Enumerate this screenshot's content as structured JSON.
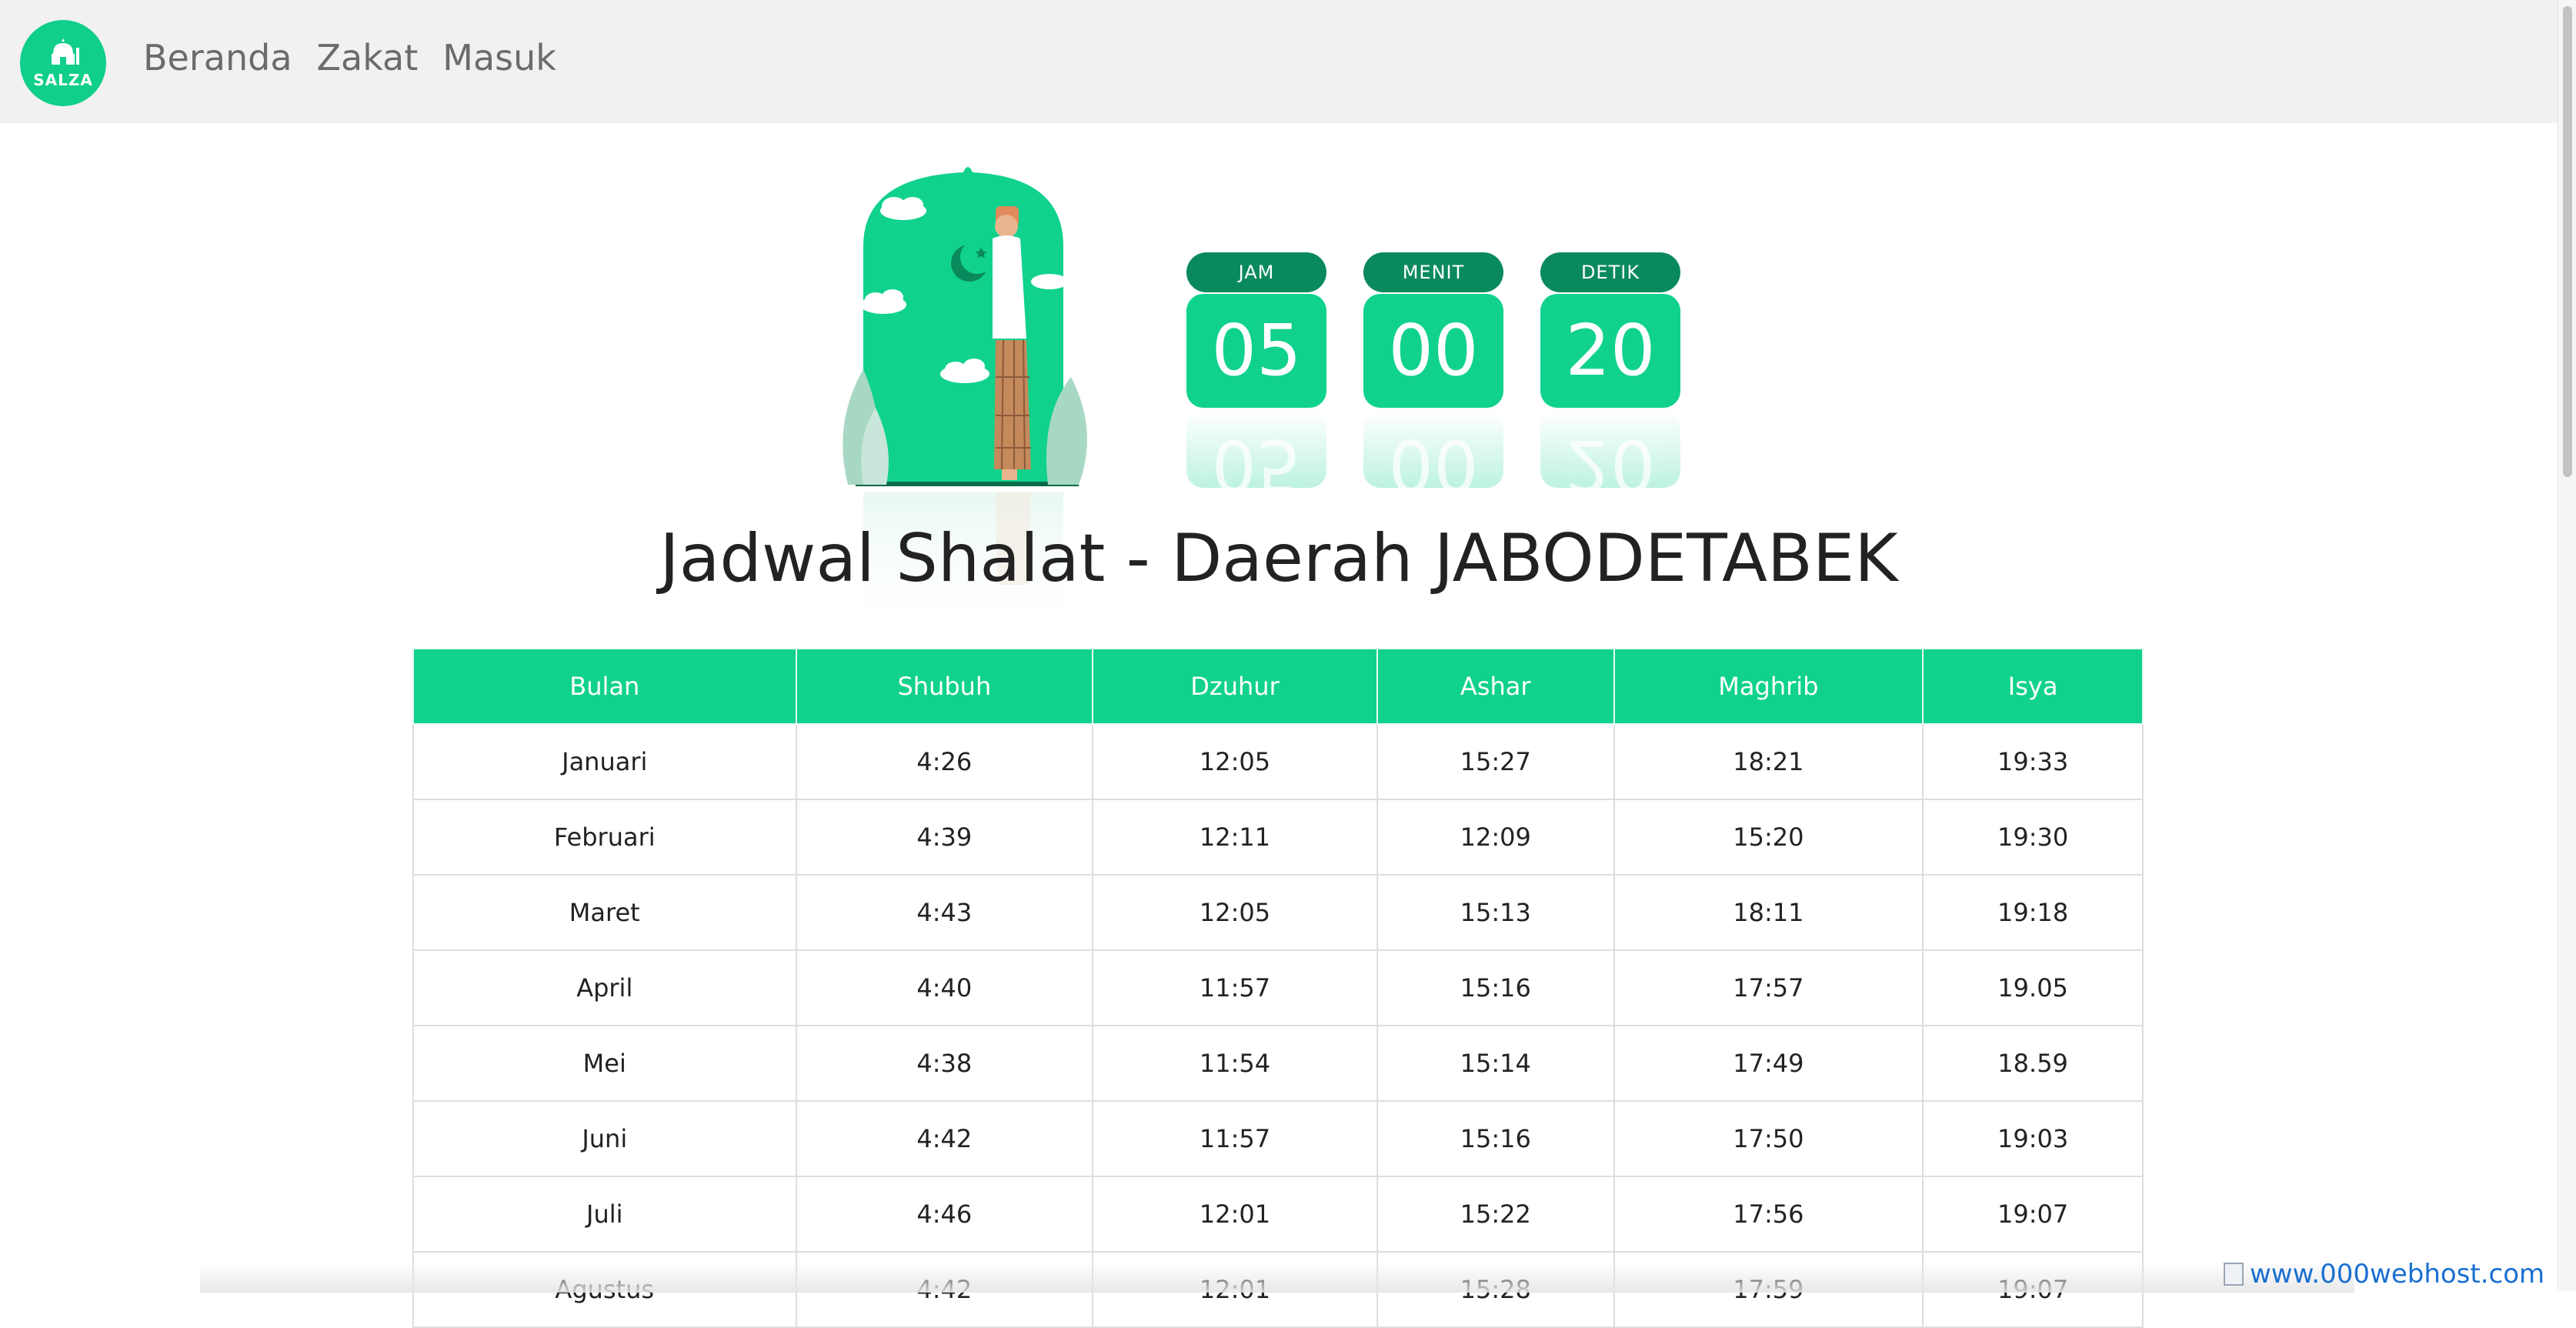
{
  "nav": {
    "logo_text": "SALZA",
    "links": [
      {
        "label": "Beranda"
      },
      {
        "label": "Zakat"
      },
      {
        "label": "Masuk"
      }
    ]
  },
  "timer": {
    "hours": {
      "label": "JAM",
      "value": "05"
    },
    "minutes": {
      "label": "MENIT",
      "value": "00"
    },
    "seconds": {
      "label": "DETIK",
      "value": "20"
    }
  },
  "page_title": "Jadwal Shalat - Daerah JABODETABEK",
  "table": {
    "headers": [
      "Bulan",
      "Shubuh",
      "Dzuhur",
      "Ashar",
      "Maghrib",
      "Isya"
    ],
    "rows": [
      [
        "Januari",
        "4:26",
        "12:05",
        "15:27",
        "18:21",
        "19:33"
      ],
      [
        "Februari",
        "4:39",
        "12:11",
        "12:09",
        "15:20",
        "19:30"
      ],
      [
        "Maret",
        "4:43",
        "12:05",
        "15:13",
        "18:11",
        "19:18"
      ],
      [
        "April",
        "4:40",
        "11:57",
        "15:16",
        "17:57",
        "19.05"
      ],
      [
        "Mei",
        "4:38",
        "11:54",
        "15:14",
        "17:49",
        "18.59"
      ],
      [
        "Juni",
        "4:42",
        "11:57",
        "15:16",
        "17:50",
        "19:03"
      ],
      [
        "Juli",
        "4:46",
        "12:01",
        "15:22",
        "17:56",
        "19:07"
      ],
      [
        "Agustus",
        "4:42",
        "12:01",
        "15:28",
        "17:59",
        "19:07"
      ]
    ]
  },
  "footer": {
    "badge_text": "www.000webhost.com"
  },
  "colors": {
    "accent": "#10d28c",
    "accent_dark": "#0a8a5c",
    "navbar_bg": "#f1f1f1"
  }
}
